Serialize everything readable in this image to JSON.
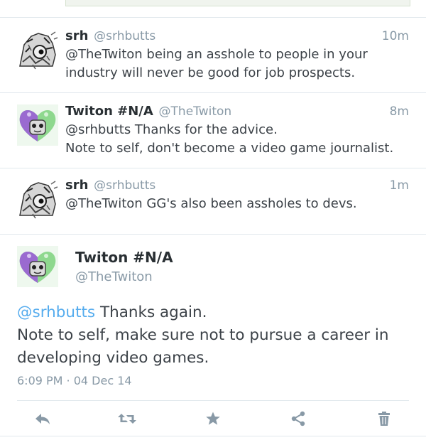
{
  "tweets": [
    {
      "name": "srh",
      "handle": "@srhbutts",
      "time": "10m",
      "text_line1": "@TheTwiton being an asshole to people in your",
      "text_line2": "industry will never be good for job prospects.",
      "avatar": "grey-creature-avatar"
    },
    {
      "name": "Twiton #N/A",
      "handle": "@TheTwiton",
      "time": "8m",
      "text_line1": "@srhbutts Thanks for the advice.",
      "text_line2": "Note to self, don't become a video game journalist.",
      "avatar": "heart-balloon-avatar"
    },
    {
      "name": "srh",
      "handle": "@srhbutts",
      "time": "1m",
      "text_line1": "@TheTwiton GG's also been assholes to devs.",
      "avatar": "grey-creature-avatar"
    }
  ],
  "detail": {
    "name": "Twiton #N/A",
    "handle": "@TheTwiton",
    "mention": "@srhbutts",
    "text_rest": " Thanks again.",
    "text_line2": "Note to self, make sure not to pursue a career in",
    "text_line3": "developing video games.",
    "timestamp": "6:09 PM · 04 Dec 14",
    "avatar": "heart-balloon-avatar"
  },
  "actions": [
    "reply-icon",
    "retweet-icon",
    "favorite-icon",
    "share-icon",
    "delete-icon"
  ],
  "colors": {
    "accent": "#55acee",
    "muted": "#8899a6",
    "text": "#3c4248",
    "divider": "#e1e8ed"
  }
}
